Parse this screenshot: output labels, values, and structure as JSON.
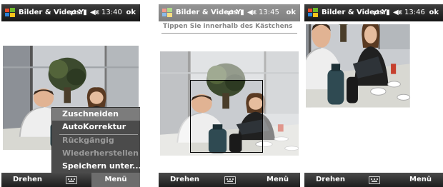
{
  "screens": [
    {
      "titlebar": {
        "title": "Bilder & Videos",
        "time": "13:40",
        "ok": "ok"
      },
      "menu": {
        "items": [
          {
            "label": "Zuschneiden",
            "state": "selected"
          },
          {
            "label": "AutoKorrektur",
            "state": "enabled"
          },
          {
            "label": "Rückgängig",
            "state": "disabled"
          },
          {
            "label": "Wiederherstellen",
            "state": "disabled"
          },
          {
            "label": "Speichern unter...",
            "state": "enabled"
          }
        ]
      },
      "softkeys": {
        "left": "Drehen",
        "right": "Menü"
      }
    },
    {
      "titlebar": {
        "title": "Bilder & Videos",
        "time": "13:45",
        "ok": "ok"
      },
      "instruction": "Tippen Sie innerhalb des Kästchens",
      "softkeys": {
        "left": "Drehen",
        "right": "Menü"
      }
    },
    {
      "titlebar": {
        "title": "Bilder & Videos",
        "time": "13:46",
        "ok": "ok"
      },
      "softkeys": {
        "left": "Drehen",
        "right": "Menü"
      }
    }
  ],
  "colors": {
    "titlebar": "#222222",
    "softkeys": "#2a2a2a",
    "menu_bg": "#4b4b4b",
    "menu_selected": "#7c7c7c",
    "menu_disabled_text": "#9a9a9a"
  },
  "icons": {
    "start": "windows-flag-icon",
    "sync": "sync-arrows-icon",
    "signal": "signal-strength-icon",
    "volume": "speaker-icon",
    "keyboard": "keyboard-icon"
  }
}
